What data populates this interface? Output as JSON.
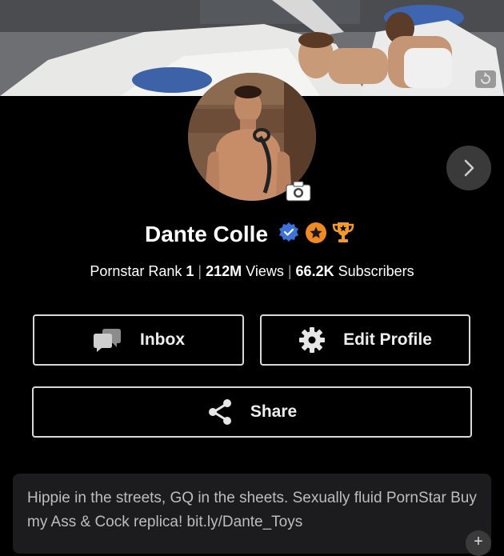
{
  "profile": {
    "name": "Dante Colle",
    "stats": {
      "rank_label": "Pornstar Rank",
      "rank_value": "1",
      "views_value": "212M",
      "views_label": "Views",
      "subscribers_value": "66.2K",
      "subscribers_label": "Subscribers",
      "separator": "|"
    },
    "bio": "Hippie in the streets, GQ in the sheets. Sexually fluid PornStar Buy my Ass & Cock replica! bit.ly/Dante_Toys"
  },
  "actions": {
    "inbox_label": "Inbox",
    "edit_label": "Edit Profile",
    "share_label": "Share",
    "bio_expand_label": "+"
  },
  "colors": {
    "background": "#000000",
    "verified_badge": "#3b73d9",
    "star_badge": "#f08a24",
    "trophy": "#f29a2e",
    "button_border": "#d9d9d9",
    "bio_background": "#1c1c1e"
  },
  "icons": [
    "cover-edit-icon",
    "camera-icon",
    "chevron-right-icon",
    "verified-icon",
    "star-badge-icon",
    "trophy-icon",
    "chat-bubbles-icon",
    "gear-icon",
    "share-icon"
  ]
}
